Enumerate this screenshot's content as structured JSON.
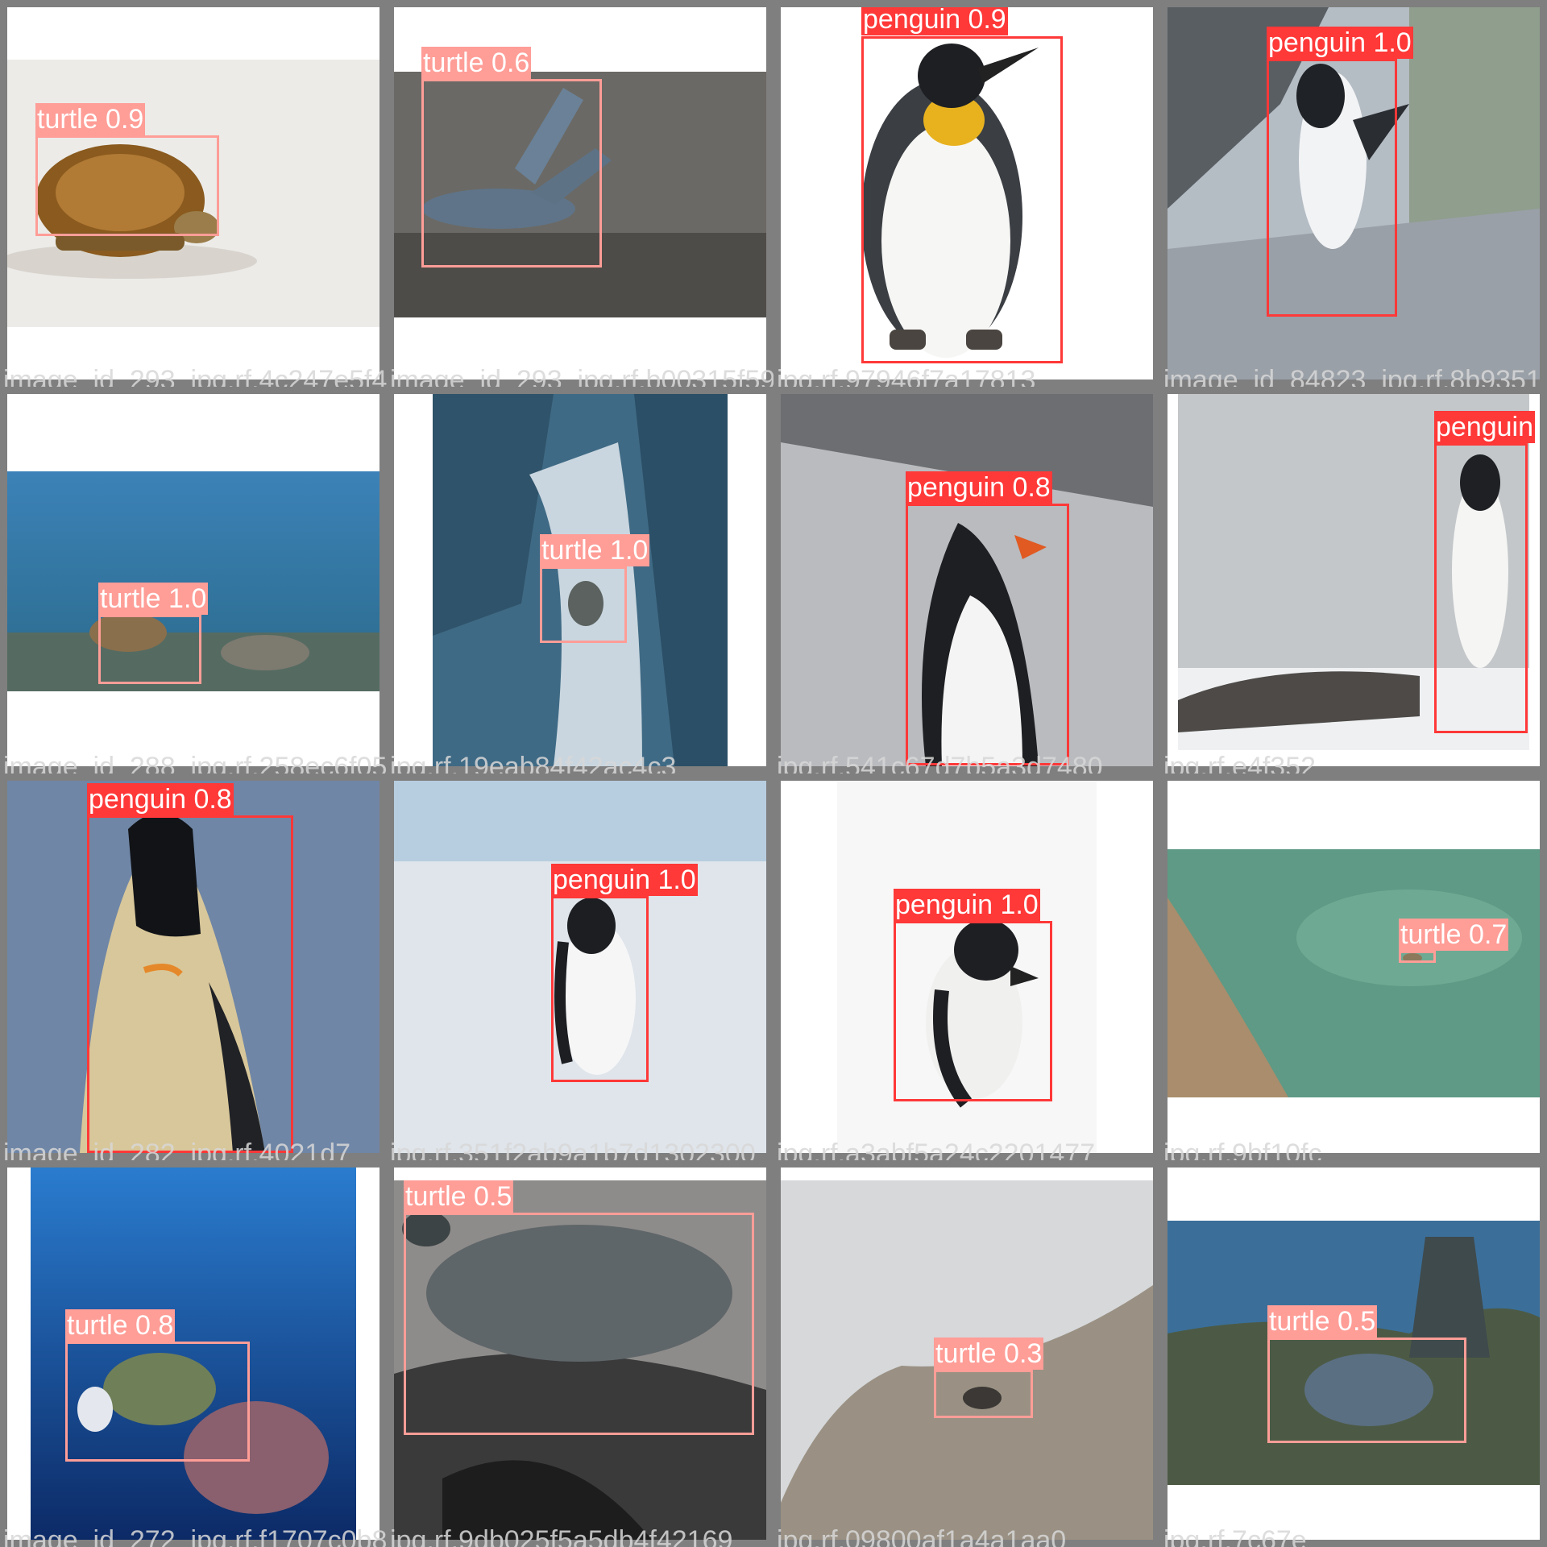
{
  "legend_colors": {
    "turtle": "#ff9d97",
    "penguin": "#ff3838"
  },
  "cells": [
    {
      "filename": "image_id_293_jpg.rf.4c247e5f4dbe0c2c7613",
      "detections": [
        {
          "label": "turtle 0.9"
        }
      ]
    },
    {
      "filename": "image_id_293_jpg.rf.b00315f59ad7c30c",
      "detections": [
        {
          "label": "turtle 0.6"
        }
      ]
    },
    {
      "filename": "jpg.rf.97946f7a17813",
      "detections": [
        {
          "label": "penguin 0.9"
        }
      ]
    },
    {
      "filename": "image_id_84823_jpg.rf.8b9351",
      "detections": [
        {
          "label": "penguin 1.0"
        }
      ]
    },
    {
      "filename": "image_id_288_jpg.rf.258ec6f05bda2f8242de",
      "detections": [
        {
          "label": "turtle 1.0"
        }
      ]
    },
    {
      "filename": "jpg.rf.19eab84f42ac4c3",
      "detections": [
        {
          "label": "turtle 1.0"
        }
      ]
    },
    {
      "filename": "jpg.rf.541c67d7b5a3d7480",
      "detections": [
        {
          "label": "penguin 0.8"
        }
      ]
    },
    {
      "filename": "jpg.rf.e4f352",
      "detections": [
        {
          "label": "penguin"
        }
      ]
    },
    {
      "filename": "image_id_282_jpg.rf.4021d7",
      "detections": [
        {
          "label": "penguin 0.8"
        }
      ]
    },
    {
      "filename": "jpg.rf.351f2ab9a1b7d1302300",
      "detections": [
        {
          "label": "penguin 1.0"
        }
      ]
    },
    {
      "filename": "jpg.rf.a3abf5a24c2201477",
      "detections": [
        {
          "label": "penguin 1.0"
        }
      ]
    },
    {
      "filename": "jpg.rf.9bf10fc",
      "detections": [
        {
          "label": "turtle 0.7"
        }
      ]
    },
    {
      "filename": "image_id_272_jpg.rf.f1707c0b8f08b0c65130",
      "detections": [
        {
          "label": "turtle 0.8"
        }
      ]
    },
    {
      "filename": "jpg.rf.9db025f5a5db4f42169",
      "detections": [
        {
          "label": "turtle 0.5"
        }
      ]
    },
    {
      "filename": "jpg.rf.09800af1a4a1aa0",
      "detections": [
        {
          "label": "turtle 0.3"
        }
      ]
    },
    {
      "filename": "jpg.rf.7c67e",
      "detections": [
        {
          "label": "turtle 0.5"
        }
      ]
    }
  ]
}
